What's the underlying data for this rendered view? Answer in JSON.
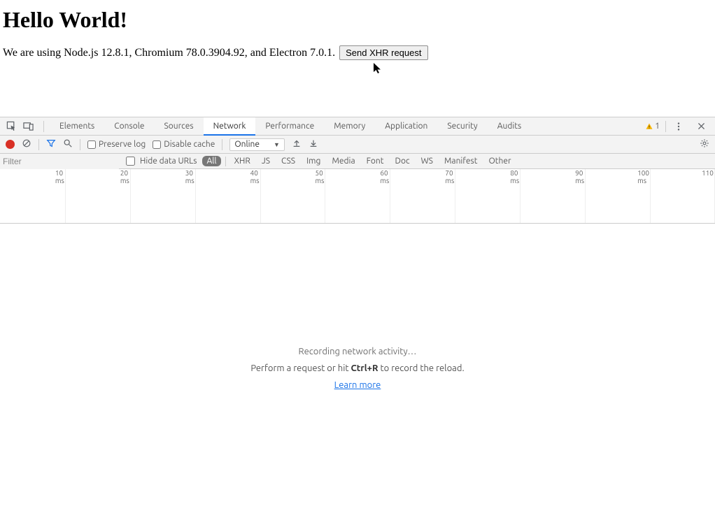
{
  "page": {
    "heading": "Hello World!",
    "body_text": "We are using Node.js 12.8.1, Chromium 78.0.3904.92, and Electron 7.0.1.",
    "button_label": "Send XHR request"
  },
  "devtools": {
    "tabs": [
      "Elements",
      "Console",
      "Sources",
      "Network",
      "Performance",
      "Memory",
      "Application",
      "Security",
      "Audits"
    ],
    "active_tab": "Network",
    "warnings_count": "1",
    "toolbar": {
      "preserve_log_label": "Preserve log",
      "disable_cache_label": "Disable cache",
      "throttling_value": "Online"
    },
    "filterbar": {
      "filter_placeholder": "Filter",
      "hide_data_urls_label": "Hide data URLs",
      "types": [
        "All",
        "XHR",
        "JS",
        "CSS",
        "Img",
        "Media",
        "Font",
        "Doc",
        "WS",
        "Manifest",
        "Other"
      ],
      "active_type": "All"
    },
    "timeline_ticks": [
      "10 ms",
      "20 ms",
      "30 ms",
      "40 ms",
      "50 ms",
      "60 ms",
      "70 ms",
      "80 ms",
      "90 ms",
      "100 ms",
      "110"
    ],
    "empty": {
      "line1": "Recording network activity…",
      "line2a": "Perform a request or hit ",
      "line2b": "Ctrl+R",
      "line2c": " to record the reload.",
      "learn_more": "Learn more"
    }
  }
}
